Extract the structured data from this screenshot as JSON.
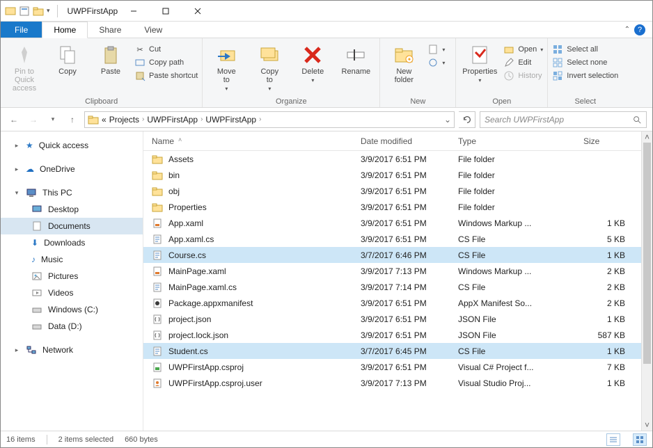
{
  "title": "UWPFirstApp",
  "tabs": {
    "file": "File",
    "home": "Home",
    "share": "Share",
    "view": "View"
  },
  "ribbon": {
    "clipboard": {
      "label": "Clipboard",
      "pin": "Pin to Quick\naccess",
      "copy": "Copy",
      "paste": "Paste",
      "cut": "Cut",
      "copy_path": "Copy path",
      "paste_shortcut": "Paste shortcut"
    },
    "organize": {
      "label": "Organize",
      "move_to": "Move\nto",
      "copy_to": "Copy\nto",
      "delete": "Delete",
      "rename": "Rename"
    },
    "new": {
      "label": "New",
      "new_folder": "New\nfolder"
    },
    "open": {
      "label": "Open",
      "properties": "Properties",
      "open": "Open",
      "edit": "Edit",
      "history": "History"
    },
    "select": {
      "label": "Select",
      "select_all": "Select all",
      "select_none": "Select none",
      "invert": "Invert selection"
    }
  },
  "breadcrumb": {
    "prefix": "«",
    "items": [
      "Projects",
      "UWPFirstApp",
      "UWPFirstApp"
    ]
  },
  "search": {
    "placeholder": "Search UWPFirstApp"
  },
  "nav": {
    "quick_access": "Quick access",
    "onedrive": "OneDrive",
    "this_pc": "This PC",
    "desktop": "Desktop",
    "documents": "Documents",
    "downloads": "Downloads",
    "music": "Music",
    "pictures": "Pictures",
    "videos": "Videos",
    "windows_c": "Windows (C:)",
    "data_d": "Data (D:)",
    "network": "Network"
  },
  "columns": {
    "name": "Name",
    "date": "Date modified",
    "type": "Type",
    "size": "Size"
  },
  "files": [
    {
      "name": "Assets",
      "date": "3/9/2017 6:51 PM",
      "type": "File folder",
      "size": "",
      "icon": "folder",
      "selected": false
    },
    {
      "name": "bin",
      "date": "3/9/2017 6:51 PM",
      "type": "File folder",
      "size": "",
      "icon": "folder",
      "selected": false
    },
    {
      "name": "obj",
      "date": "3/9/2017 6:51 PM",
      "type": "File folder",
      "size": "",
      "icon": "folder",
      "selected": false
    },
    {
      "name": "Properties",
      "date": "3/9/2017 6:51 PM",
      "type": "File folder",
      "size": "",
      "icon": "folder",
      "selected": false
    },
    {
      "name": "App.xaml",
      "date": "3/9/2017 6:51 PM",
      "type": "Windows Markup ...",
      "size": "1 KB",
      "icon": "xaml",
      "selected": false
    },
    {
      "name": "App.xaml.cs",
      "date": "3/9/2017 6:51 PM",
      "type": "CS File",
      "size": "5 KB",
      "icon": "cs",
      "selected": false
    },
    {
      "name": "Course.cs",
      "date": "3/7/2017 6:46 PM",
      "type": "CS File",
      "size": "1 KB",
      "icon": "cs",
      "selected": true
    },
    {
      "name": "MainPage.xaml",
      "date": "3/9/2017 7:13 PM",
      "type": "Windows Markup ...",
      "size": "2 KB",
      "icon": "xaml",
      "selected": false
    },
    {
      "name": "MainPage.xaml.cs",
      "date": "3/9/2017 7:14 PM",
      "type": "CS File",
      "size": "2 KB",
      "icon": "cs",
      "selected": false
    },
    {
      "name": "Package.appxmanifest",
      "date": "3/9/2017 6:51 PM",
      "type": "AppX Manifest So...",
      "size": "2 KB",
      "icon": "manifest",
      "selected": false
    },
    {
      "name": "project.json",
      "date": "3/9/2017 6:51 PM",
      "type": "JSON File",
      "size": "1 KB",
      "icon": "json",
      "selected": false
    },
    {
      "name": "project.lock.json",
      "date": "3/9/2017 6:51 PM",
      "type": "JSON File",
      "size": "587 KB",
      "icon": "json",
      "selected": false
    },
    {
      "name": "Student.cs",
      "date": "3/7/2017 6:45 PM",
      "type": "CS File",
      "size": "1 KB",
      "icon": "cs",
      "selected": true
    },
    {
      "name": "UWPFirstApp.csproj",
      "date": "3/9/2017 6:51 PM",
      "type": "Visual C# Project f...",
      "size": "7 KB",
      "icon": "csproj",
      "selected": false
    },
    {
      "name": "UWPFirstApp.csproj.user",
      "date": "3/9/2017 7:13 PM",
      "type": "Visual Studio Proj...",
      "size": "1 KB",
      "icon": "user",
      "selected": false
    }
  ],
  "status": {
    "items": "16 items",
    "selected": "2 items selected",
    "bytes": "660 bytes"
  }
}
